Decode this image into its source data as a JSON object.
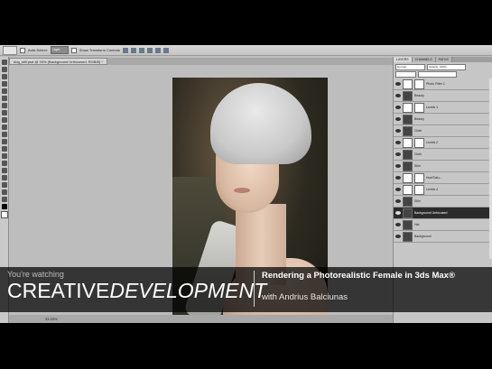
{
  "document": {
    "tab_label": "dog_still.psd @ 33% (Background Unfocused, RGB/8) *"
  },
  "options_bar": {
    "auto_select_label": "Auto-Select:",
    "layer_value": "Layer",
    "transform_label": "Show Transform Controls"
  },
  "panels": {
    "tabs": [
      "LAYERS",
      "CHANNELS",
      "PATHS"
    ],
    "blend_mode": "Normal",
    "opacity_label": "Opacity: 100%",
    "layers": [
      {
        "name": "Photo Filter 1"
      },
      {
        "name": "Beauty"
      },
      {
        "name": "Levels 1"
      },
      {
        "name": "Beauty"
      },
      {
        "name": "Cloth"
      },
      {
        "name": "Levels 2"
      },
      {
        "name": "Cloth"
      },
      {
        "name": "Skin"
      },
      {
        "name": "Hue/Satu..."
      },
      {
        "name": "Levels 4"
      },
      {
        "name": "Skin"
      },
      {
        "name": "Background Unfocused"
      },
      {
        "name": "Hat"
      },
      {
        "name": "Background"
      }
    ]
  },
  "status_bar": {
    "zoom": "33.33%"
  },
  "overlay": {
    "watching": "You're watching",
    "brand_part1": "CREATIVE",
    "brand_part2": "DEVELOPMENT",
    "course_title": "Rendering a Photorealistic Female in 3ds Max®",
    "author": "with Andrius Balciunas"
  }
}
